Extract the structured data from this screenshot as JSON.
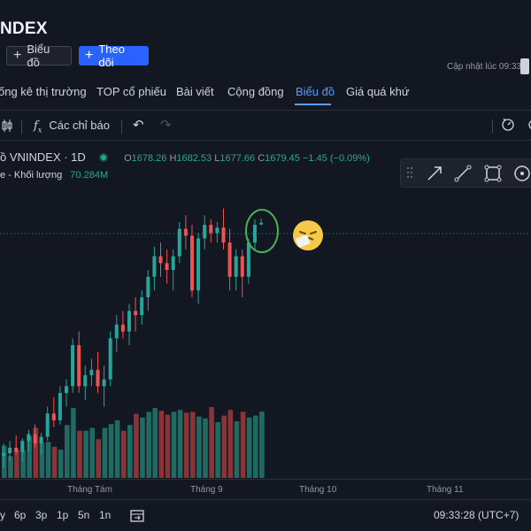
{
  "header": {
    "title": "NDEX",
    "chart_button": "Biểu đồ",
    "follow_button": "Theo dõi",
    "updated_label": "Cập nhật lúc  09:33:"
  },
  "tabs": [
    {
      "label": "ống kê thị trường",
      "active": false
    },
    {
      "label": "TOP cổ phiếu",
      "active": false
    },
    {
      "label": "Bài viết",
      "active": false
    },
    {
      "label": "Cộng đồng",
      "active": false
    },
    {
      "label": "Biểu đồ",
      "active": true
    },
    {
      "label": "Giá quá khứ",
      "active": false
    }
  ],
  "toolbar": {
    "indicators": "Các chỉ báo"
  },
  "legend": {
    "symbol": "ồ VNINDEX · 1D",
    "o_label": "O",
    "o_value": "1678.26",
    "h_label": "H",
    "h_value": "1682.53",
    "l_label": "L",
    "l_value": "1677.66",
    "c_label": "C",
    "c_value": "1679.45",
    "change": "−1.45 (−0.09%)",
    "volume_label": "e - Khối lượng",
    "volume_value": "70.284M"
  },
  "time_axis": [
    "Tháng Tám",
    "Tháng 9",
    "Tháng 10",
    "Tháng 11"
  ],
  "bottom_bar": {
    "ranges": [
      "y",
      "6p",
      "3p",
      "1p",
      "5n",
      "1n"
    ],
    "clock": "09:33:28 (UTC+7)"
  },
  "colors": {
    "up": "#26a69a",
    "down": "#ef5350",
    "accent": "#2962ff",
    "annotation": "#4caf50"
  },
  "chart_data": {
    "type": "candlestick",
    "candles": [
      {
        "o": 1509,
        "h": 1518,
        "l": 1500,
        "c": 1511
      },
      {
        "o": 1511,
        "h": 1520,
        "l": 1505,
        "c": 1515
      },
      {
        "o": 1515,
        "h": 1524,
        "l": 1510,
        "c": 1512
      },
      {
        "o": 1512,
        "h": 1522,
        "l": 1505,
        "c": 1520
      },
      {
        "o": 1520,
        "h": 1528,
        "l": 1512,
        "c": 1525
      },
      {
        "o": 1525,
        "h": 1532,
        "l": 1515,
        "c": 1518
      },
      {
        "o": 1518,
        "h": 1526,
        "l": 1510,
        "c": 1523
      },
      {
        "o": 1523,
        "h": 1545,
        "l": 1520,
        "c": 1540
      },
      {
        "o": 1540,
        "h": 1552,
        "l": 1530,
        "c": 1535
      },
      {
        "o": 1535,
        "h": 1560,
        "l": 1532,
        "c": 1555
      },
      {
        "o": 1555,
        "h": 1565,
        "l": 1545,
        "c": 1560
      },
      {
        "o": 1560,
        "h": 1595,
        "l": 1555,
        "c": 1590
      },
      {
        "o": 1590,
        "h": 1600,
        "l": 1555,
        "c": 1560
      },
      {
        "o": 1560,
        "h": 1575,
        "l": 1550,
        "c": 1568
      },
      {
        "o": 1568,
        "h": 1580,
        "l": 1560,
        "c": 1572
      },
      {
        "o": 1572,
        "h": 1585,
        "l": 1555,
        "c": 1560
      },
      {
        "o": 1560,
        "h": 1575,
        "l": 1545,
        "c": 1565
      },
      {
        "o": 1565,
        "h": 1600,
        "l": 1560,
        "c": 1595
      },
      {
        "o": 1595,
        "h": 1612,
        "l": 1585,
        "c": 1605
      },
      {
        "o": 1605,
        "h": 1615,
        "l": 1595,
        "c": 1600
      },
      {
        "o": 1600,
        "h": 1620,
        "l": 1590,
        "c": 1615
      },
      {
        "o": 1615,
        "h": 1625,
        "l": 1600,
        "c": 1612
      },
      {
        "o": 1612,
        "h": 1630,
        "l": 1605,
        "c": 1625
      },
      {
        "o": 1625,
        "h": 1645,
        "l": 1615,
        "c": 1640
      },
      {
        "o": 1640,
        "h": 1662,
        "l": 1630,
        "c": 1655
      },
      {
        "o": 1655,
        "h": 1665,
        "l": 1640,
        "c": 1650
      },
      {
        "o": 1650,
        "h": 1660,
        "l": 1635,
        "c": 1645
      },
      {
        "o": 1645,
        "h": 1660,
        "l": 1630,
        "c": 1655
      },
      {
        "o": 1655,
        "h": 1680,
        "l": 1650,
        "c": 1675
      },
      {
        "o": 1675,
        "h": 1685,
        "l": 1660,
        "c": 1670
      },
      {
        "o": 1670,
        "h": 1678,
        "l": 1625,
        "c": 1630
      },
      {
        "o": 1630,
        "h": 1672,
        "l": 1620,
        "c": 1668
      },
      {
        "o": 1668,
        "h": 1685,
        "l": 1660,
        "c": 1678
      },
      {
        "o": 1678,
        "h": 1682,
        "l": 1665,
        "c": 1672
      },
      {
        "o": 1672,
        "h": 1680,
        "l": 1665,
        "c": 1676
      },
      {
        "o": 1676,
        "h": 1690,
        "l": 1660,
        "c": 1665
      },
      {
        "o": 1665,
        "h": 1675,
        "l": 1630,
        "c": 1640
      },
      {
        "o": 1640,
        "h": 1660,
        "l": 1630,
        "c": 1655
      },
      {
        "o": 1655,
        "h": 1660,
        "l": 1625,
        "c": 1640
      },
      {
        "o": 1640,
        "h": 1668,
        "l": 1635,
        "c": 1665
      },
      {
        "o": 1665,
        "h": 1682,
        "l": 1660,
        "c": 1678
      },
      {
        "o": 1678.26,
        "h": 1682.53,
        "l": 1677.66,
        "c": 1679.45
      }
    ],
    "volumes": [
      34,
      23,
      30,
      29,
      44,
      53,
      37,
      38,
      33,
      30,
      56,
      74,
      50,
      50,
      53,
      41,
      53,
      57,
      61,
      50,
      56,
      68,
      64,
      70,
      74,
      71,
      67,
      70,
      72,
      69,
      70,
      65,
      63,
      75,
      59,
      66,
      72,
      60,
      70,
      64,
      66,
      70.3
    ]
  }
}
